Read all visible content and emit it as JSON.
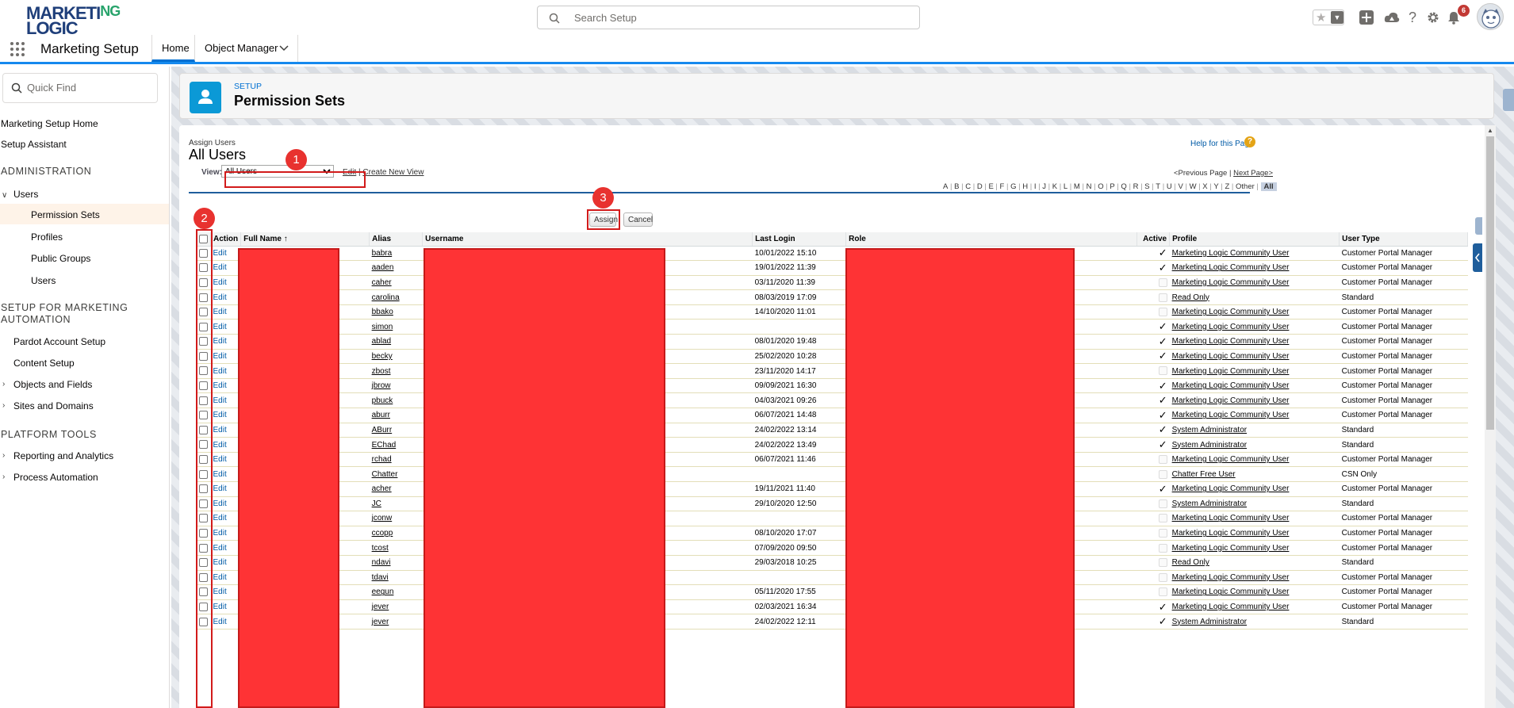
{
  "topbar": {
    "logo_line1": "MARKETI",
    "logo_ng": "NG",
    "logo_line2": "LOGIC",
    "search_placeholder": "Search Setup",
    "notification_count": "6"
  },
  "appnav": {
    "app_name": "Marketing Setup",
    "tabs": [
      {
        "label": "Home"
      },
      {
        "label": "Object Manager"
      }
    ]
  },
  "sidebar": {
    "quickfind_placeholder": "Quick Find",
    "links": [
      "Marketing Setup Home",
      "Setup Assistant"
    ],
    "admin_heading": "ADMINISTRATION",
    "users_group": "Users",
    "users_children": [
      "Permission Sets",
      "Profiles",
      "Public Groups",
      "Users"
    ],
    "marketing_heading_1": "SETUP FOR MARKETING",
    "marketing_heading_2": "AUTOMATION",
    "marketing_items": [
      "Pardot Account Setup",
      "Content Setup",
      "Objects and Fields",
      "Sites and Domains"
    ],
    "platform_heading": "PLATFORM TOOLS",
    "platform_items": [
      "Reporting and Analytics",
      "Process Automation"
    ]
  },
  "header": {
    "breadcrumb": "SETUP",
    "title": "Permission Sets"
  },
  "page": {
    "assign_users": "Assign Users",
    "view_title": "All Users",
    "help_link": "Help for this Page",
    "view_label": "View:",
    "view_selected": "All Users",
    "edit_link": "Edit",
    "create_view_link": "Create New View",
    "prev_page": "<Previous Page",
    "next_page": "Next Page>",
    "alphabet": [
      "A",
      "B",
      "C",
      "D",
      "E",
      "F",
      "G",
      "H",
      "I",
      "J",
      "K",
      "L",
      "M",
      "N",
      "O",
      "P",
      "Q",
      "R",
      "S",
      "T",
      "U",
      "V",
      "W",
      "X",
      "Y",
      "Z",
      "Other"
    ],
    "alphabet_all": "All",
    "assign_button": "Assign",
    "cancel_button": "Cancel"
  },
  "callouts": [
    "1",
    "2",
    "3"
  ],
  "table": {
    "columns": [
      "Action",
      "Full Name",
      "Alias",
      "Username",
      "Last Login",
      "Role",
      "Active",
      "Profile",
      "User Type"
    ],
    "sort_indicator": "↑",
    "action_label": "Edit",
    "rows": [
      {
        "alias": "babra",
        "last_login": "10/01/2022 15:10",
        "active": true,
        "profile": "Marketing Logic Community User",
        "user_type": "Customer Portal Manager"
      },
      {
        "alias": "aaden",
        "last_login": "19/01/2022 11:39",
        "active": true,
        "profile": "Marketing Logic Community User",
        "user_type": "Customer Portal Manager"
      },
      {
        "alias": "caher",
        "last_login": "03/11/2020 11:39",
        "active": false,
        "profile": "Marketing Logic Community User",
        "user_type": "Customer Portal Manager"
      },
      {
        "alias": "carolina",
        "last_login": "08/03/2019 17:09",
        "active": false,
        "profile": "Read Only",
        "user_type": "Standard"
      },
      {
        "alias": "bbako",
        "last_login": "14/10/2020 11:01",
        "active": false,
        "profile": "Marketing Logic Community User",
        "user_type": "Customer Portal Manager"
      },
      {
        "alias": "simon",
        "last_login": "",
        "active": true,
        "profile": "Marketing Logic Community User",
        "user_type": "Customer Portal Manager"
      },
      {
        "alias": "ablad",
        "last_login": "08/01/2020 19:48",
        "active": true,
        "profile": "Marketing Logic Community User",
        "user_type": "Customer Portal Manager"
      },
      {
        "alias": "becky",
        "last_login": "25/02/2020 10:28",
        "active": true,
        "profile": "Marketing Logic Community User",
        "user_type": "Customer Portal Manager"
      },
      {
        "alias": "zbost",
        "last_login": "23/11/2020 14:17",
        "active": false,
        "profile": "Marketing Logic Community User",
        "user_type": "Customer Portal Manager"
      },
      {
        "alias": "jbrow",
        "last_login": "09/09/2021 16:30",
        "active": true,
        "profile": "Marketing Logic Community User",
        "user_type": "Customer Portal Manager"
      },
      {
        "alias": "pbuck",
        "last_login": "04/03/2021 09:26",
        "active": true,
        "profile": "Marketing Logic Community User",
        "user_type": "Customer Portal Manager"
      },
      {
        "alias": "aburr",
        "last_login": "06/07/2021 14:48",
        "active": true,
        "profile": "Marketing Logic Community User",
        "user_type": "Customer Portal Manager"
      },
      {
        "alias": "ABurr",
        "last_login": "24/02/2022 13:14",
        "active": true,
        "profile": "System Administrator",
        "user_type": "Standard"
      },
      {
        "alias": "EChad",
        "last_login": "24/02/2022 13:49",
        "active": true,
        "profile": "System Administrator",
        "user_type": "Standard"
      },
      {
        "alias": "rchad",
        "last_login": "06/07/2021 11:46",
        "active": false,
        "profile": "Marketing Logic Community User",
        "user_type": "Customer Portal Manager"
      },
      {
        "alias": "Chatter",
        "last_login": "",
        "active": false,
        "profile": "Chatter Free User",
        "user_type": "CSN Only"
      },
      {
        "alias": "acher",
        "last_login": "19/11/2021 11:40",
        "active": true,
        "profile": "Marketing Logic Community User",
        "user_type": "Customer Portal Manager"
      },
      {
        "alias": "JC",
        "last_login": "29/10/2020 12:50",
        "active": false,
        "profile": "System Administrator",
        "user_type": "Standard"
      },
      {
        "alias": "jconw",
        "last_login": "",
        "active": false,
        "profile": "Marketing Logic Community User",
        "user_type": "Customer Portal Manager"
      },
      {
        "alias": "ccopp",
        "last_login": "08/10/2020 17:07",
        "active": false,
        "profile": "Marketing Logic Community User",
        "user_type": "Customer Portal Manager"
      },
      {
        "alias": "tcost",
        "last_login": "07/09/2020 09:50",
        "active": false,
        "profile": "Marketing Logic Community User",
        "user_type": "Customer Portal Manager"
      },
      {
        "alias": "ndavi",
        "last_login": "29/03/2018 10:25",
        "active": false,
        "profile": "Read Only",
        "user_type": "Standard"
      },
      {
        "alias": "tdavi",
        "last_login": "",
        "active": false,
        "profile": "Marketing Logic Community User",
        "user_type": "Customer Portal Manager"
      },
      {
        "alias": "eegun",
        "last_login": "05/11/2020 17:55",
        "active": false,
        "profile": "Marketing Logic Community User",
        "user_type": "Customer Portal Manager"
      },
      {
        "alias": "jever",
        "last_login": "02/03/2021 16:34",
        "active": true,
        "profile": "Marketing Logic Community User",
        "user_type": "Customer Portal Manager"
      },
      {
        "alias": "jever",
        "last_login": "24/02/2022 12:11",
        "active": true,
        "profile": "System Administrator",
        "user_type": "Standard"
      }
    ]
  }
}
